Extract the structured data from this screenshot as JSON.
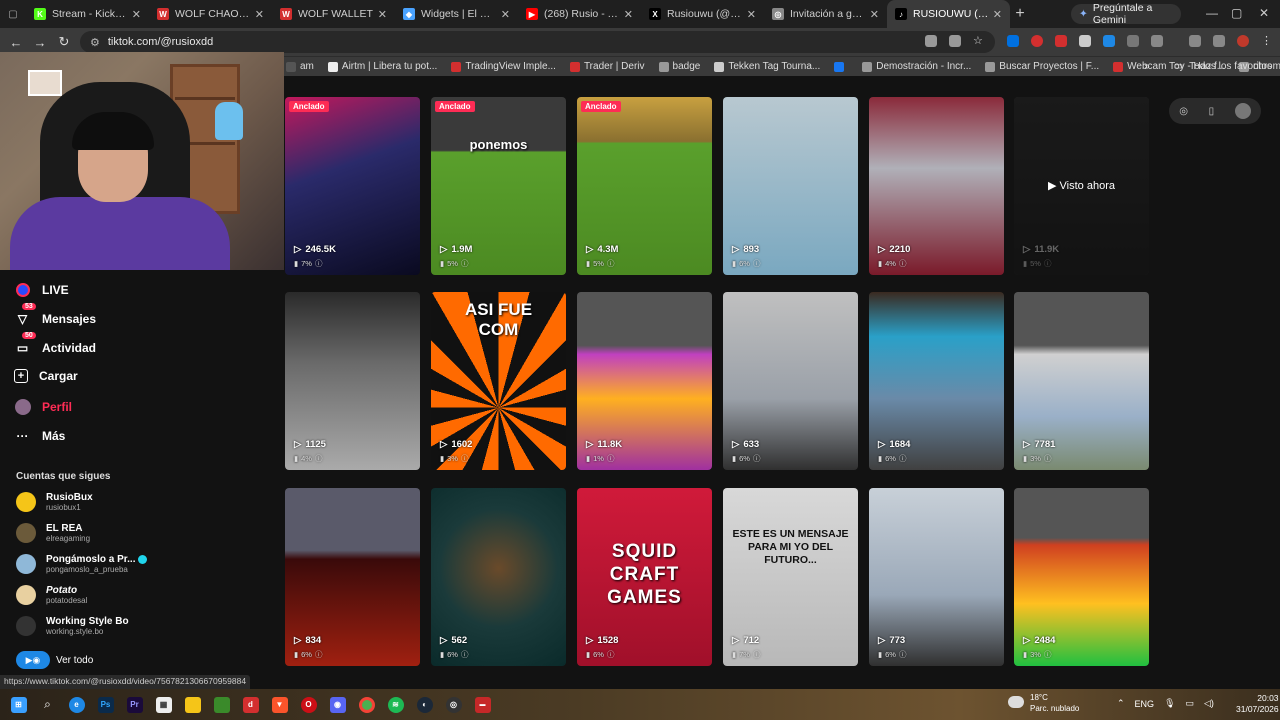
{
  "browser": {
    "tabs": [
      {
        "title": "Stream - Kick Dashb",
        "fav_color": "#53fc18",
        "fav_glyph": "K"
      },
      {
        "title": "WOLF CHAOS — Co",
        "fav_color": "#d32f2f",
        "fav_glyph": "W"
      },
      {
        "title": "WOLF WALLET",
        "fav_color": "#d32f2f",
        "fav_glyph": "W"
      },
      {
        "title": "Widgets | El mejor s",
        "fav_color": "#4aa3ff",
        "fav_glyph": "◆"
      },
      {
        "title": "(268) Rusio - YouTub",
        "fav_color": "#ff0000",
        "fav_glyph": "▶"
      },
      {
        "title": "Rusiouwu (@Rusiou",
        "fav_color": "#000000",
        "fav_glyph": "X"
      },
      {
        "title": "Invitación a grupo de",
        "fav_color": "#888888",
        "fav_glyph": "◎"
      },
      {
        "title": "RUSIOUWU (@rusio",
        "fav_color": "#000000",
        "fav_glyph": "♪",
        "active": true
      }
    ],
    "gemini_label": "Pregúntale a Gemini",
    "url": "tiktok.com/@rusioxdd",
    "bookmarks": [
      {
        "label": "am",
        "color": "#555"
      },
      {
        "label": "Airtm | Libera tu pot...",
        "color": "#eee"
      },
      {
        "label": "TradingView Imple...",
        "color": "#d32f2f"
      },
      {
        "label": "Trader | Deriv",
        "color": "#d32f2f"
      },
      {
        "label": "badge",
        "color": "#999"
      },
      {
        "label": "Tekken Tag Tourna...",
        "color": "#ccc"
      },
      {
        "label": "",
        "color": "#1877f2"
      },
      {
        "label": "Demostración - Incr...",
        "color": "#999"
      },
      {
        "label": "Buscar Proyectos | F...",
        "color": "#999"
      },
      {
        "label": "Webcam Toy - Haz f...",
        "color": "#d32f2f"
      },
      {
        "label": "chrome://dino/",
        "color": "#999"
      }
    ],
    "all_bookmarks": "Todos los favoritos",
    "status_url": "https://www.tiktok.com/@rusioxdd/video/7567821306670959884"
  },
  "nav": {
    "live": "LIVE",
    "messages": "Mensajes",
    "messages_badge": "53",
    "activity": "Actividad",
    "activity_badge": "50",
    "upload": "Cargar",
    "profile": "Perfil",
    "more": "Más",
    "following_title": "Cuentas que sigues",
    "following": [
      {
        "name": "RusioBux",
        "handle": "rusiobux1",
        "color": "#f5c518",
        "verified": false,
        "italic": false
      },
      {
        "name": "EL REA",
        "handle": "elreagaming",
        "color": "#6b5a3a",
        "verified": false,
        "italic": false
      },
      {
        "name": "Pongámoslo a Pr...",
        "handle": "pongamoslo_a_prueba",
        "color": "#8fb8d8",
        "verified": true,
        "italic": false
      },
      {
        "name": "Potato",
        "handle": "potatodesal",
        "color": "#e8d0a0",
        "verified": false,
        "italic": true
      },
      {
        "name": "Working Style Bo",
        "handle": "working.style.bo",
        "color": "#333",
        "verified": false,
        "italic": false
      }
    ],
    "see_all": "Ver todo"
  },
  "grid": {
    "pinned_label": "Anclado",
    "watched_label": "Visto ahora",
    "videos": [
      {
        "views": "246.5K",
        "pct": "7%",
        "pinned": true,
        "bg": "linear-gradient(160deg,#c2185b 0%,#2a2a6a 40%,#0a0a20 100%)",
        "caption": ""
      },
      {
        "views": "1.9M",
        "pct": "5%",
        "pinned": true,
        "bg": "linear-gradient(180deg,#3a3a3a 0%,#3a3a3a 30%,#5aa02c 31%,#4c8a22 100%)",
        "caption": "ponemos"
      },
      {
        "views": "4.3M",
        "pct": "5%",
        "pinned": true,
        "bg": "linear-gradient(180deg,#c8a040 0%,#8a7030 25%,#5aa02c 26%,#4c8a22 100%)",
        "caption": ""
      },
      {
        "views": "893",
        "pct": "6%",
        "pinned": false,
        "bg": "linear-gradient(180deg,#b8c8d0 0%,#7aa8c0 100%)",
        "caption": ""
      },
      {
        "views": "2210",
        "pct": "4%",
        "pinned": false,
        "bg": "linear-gradient(180deg,#8a2a3a 0%,#b0b0b8 40%,#7a1a2a 100%)",
        "caption": ""
      },
      {
        "views": "11.9K",
        "pct": "5%",
        "pinned": false,
        "watched": true,
        "bg": "linear-gradient(180deg,#3a3a3a 0%,#2a2a2a 100%)",
        "caption": ""
      },
      {
        "views": "1125",
        "pct": "4%",
        "pinned": false,
        "bg": "linear-gradient(180deg,#2a2a2a 0%,#6a6a6a 40%,#aaaaaa 100%)",
        "caption": ""
      },
      {
        "views": "1602",
        "pct": "3%",
        "pinned": false,
        "bg": "repeating-conic-gradient(from 0deg at 50% 65%,#ff6a00 0deg 15deg,#111 15deg 30deg)",
        "caption": "ASI FUE COM"
      },
      {
        "views": "11.8K",
        "pct": "1%",
        "pinned": false,
        "bg": "linear-gradient(180deg,#555 0%,#555 30%,#c040c0 35%,#ffb020 60%,#a030a0 100%)",
        "caption": ""
      },
      {
        "views": "633",
        "pct": "6%",
        "pinned": false,
        "bg": "linear-gradient(180deg,#c0c0c0 0%,#9aa0a8 60%,#303030 100%)",
        "caption": ""
      },
      {
        "views": "1684",
        "pct": "6%",
        "pinned": false,
        "bg": "linear-gradient(180deg,#3a2a20 0%,#2aa0c8 25%,#6a8aa8 60%,#404040 100%)",
        "caption": ""
      },
      {
        "views": "7781",
        "pct": "3%",
        "pinned": false,
        "bg": "linear-gradient(180deg,#555 0%,#555 30%,#d0d0d0 35%,#9ab0c8 70%,#7a8a70 100%)",
        "caption": ""
      },
      {
        "views": "834",
        "pct": "6%",
        "pinned": false,
        "bg": "linear-gradient(180deg,#5a5a6a 0%,#5a5a6a 35%,#3a0a0a 40%,#a02010 100%)",
        "caption": ""
      },
      {
        "views": "562",
        "pct": "6%",
        "pinned": false,
        "bg": "radial-gradient(circle at 50% 45%,#6a4a2a 0%,#1a3a3a 50%,#0a2a2a 100%)",
        "caption": ""
      },
      {
        "views": "1528",
        "pct": "6%",
        "pinned": false,
        "bg": "linear-gradient(180deg,#d01a3a 0%,#a0102a 100%)",
        "caption": "SQUID CRAFT GAMES"
      },
      {
        "views": "712",
        "pct": "7%",
        "pinned": false,
        "bg": "linear-gradient(180deg,#d8d8d8 0%,#b8b8b8 100%)",
        "caption": "ESTE ES UN MENSAJE PARA MI YO DEL FUTURO..."
      },
      {
        "views": "773",
        "pct": "6%",
        "pinned": false,
        "bg": "linear-gradient(180deg,#c8d0d8 0%,#9aa8b8 60%,#303030 100%)",
        "caption": ""
      },
      {
        "views": "2484",
        "pct": "3%",
        "pinned": false,
        "bg": "linear-gradient(180deg,#555 0%,#555 28%,#d04020 32%,#ffc020 65%,#20c040 100%)",
        "caption": ""
      }
    ]
  },
  "taskbar": {
    "weather_temp": "18°C",
    "weather_desc": "Parc. nublado",
    "lang": "ENG",
    "time": "20:03",
    "date": "31/07/2026"
  }
}
